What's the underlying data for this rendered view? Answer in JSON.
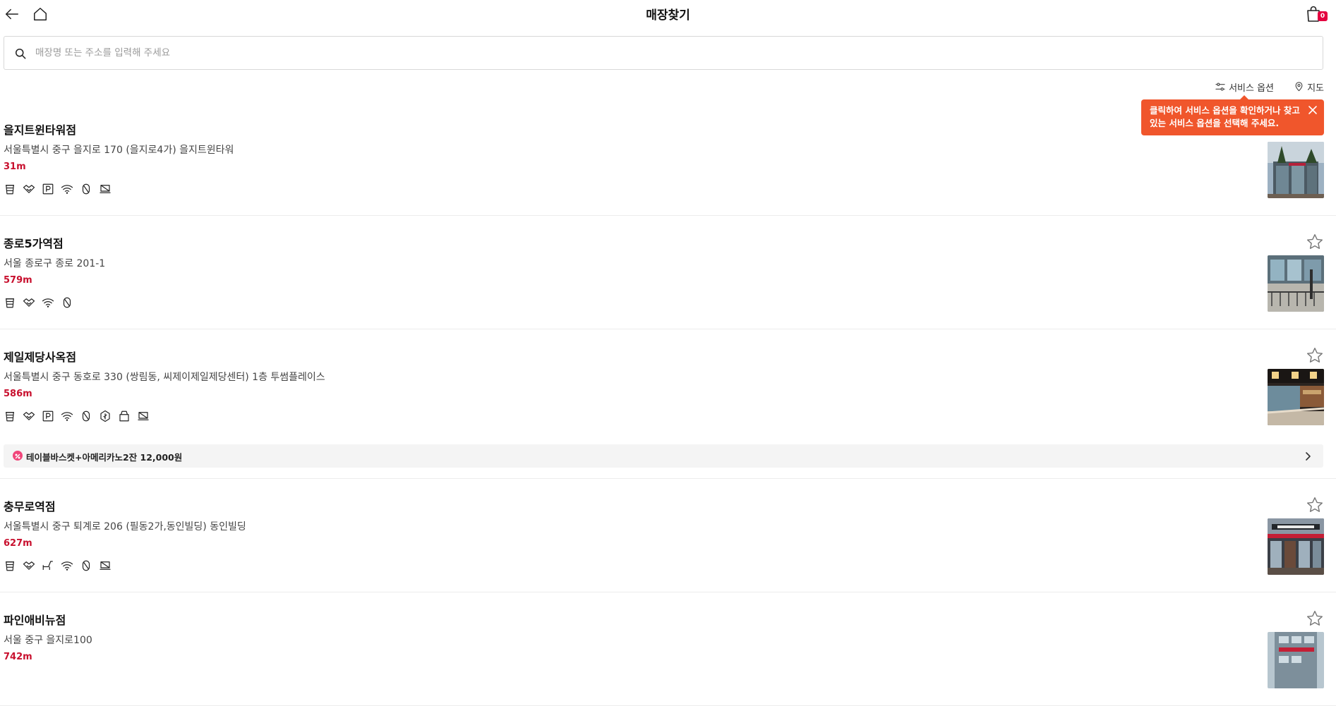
{
  "header": {
    "title": "매장찾기",
    "back_icon": "arrow-left-icon",
    "home_icon": "home-icon",
    "cart_icon": "shopping-bag-icon",
    "cart_count": "0"
  },
  "search": {
    "placeholder": "매장명 또는 주소를 입력해 주세요",
    "value": ""
  },
  "filters": {
    "service_option_label": "서비스 옵션",
    "map_label": "지도"
  },
  "tooltip": {
    "text": "클릭하여 서비스 옵션을 확인하거나 찾고 있는 서비스 옵션을 선택해 주세요."
  },
  "colors": {
    "accent": "#c8102e",
    "tooltip_bg": "#f0562c",
    "badge": "#e4003f"
  },
  "stores": [
    {
      "name": "을지트윈타워점",
      "address": "서울특별시 중구 을지로 170 (을지로4가) 을지트윈타워",
      "distance": "31m",
      "services": [
        "cup-icon",
        "handshake-icon",
        "parking-icon",
        "wifi-icon",
        "no-smoking-icon",
        "laptop-icon"
      ]
    },
    {
      "name": "종로5가역점",
      "address": "서울 종로구 종로 201-1",
      "distance": "579m",
      "services": [
        "cup-icon",
        "handshake-icon",
        "wifi-icon",
        "no-smoking-icon"
      ]
    },
    {
      "name": "제일제당사옥점",
      "address": "서울특별시 중구 동호로 330 (쌍림동, 씨제이제일제당센터) 1층 투썸플레이스",
      "distance": "586m",
      "services": [
        "cup-icon",
        "handshake-icon",
        "parking-icon",
        "wifi-icon",
        "no-smoking-icon",
        "eco-icon",
        "cake-box-icon",
        "laptop-icon"
      ],
      "promo": "테이블바스켓+아메리카노2잔 12,000원"
    },
    {
      "name": "충무로역점",
      "address": "서울특별시 중구 퇴계로 206 (필동2가,동인빌딩) 동인빌딩",
      "distance": "627m",
      "services": [
        "cup-icon",
        "handshake-icon",
        "lounge-chair-icon",
        "wifi-icon",
        "no-smoking-icon",
        "laptop-icon"
      ]
    },
    {
      "name": "파인애비뉴점",
      "address": "서울 중구 을지로100",
      "distance": "742m",
      "services": []
    }
  ]
}
